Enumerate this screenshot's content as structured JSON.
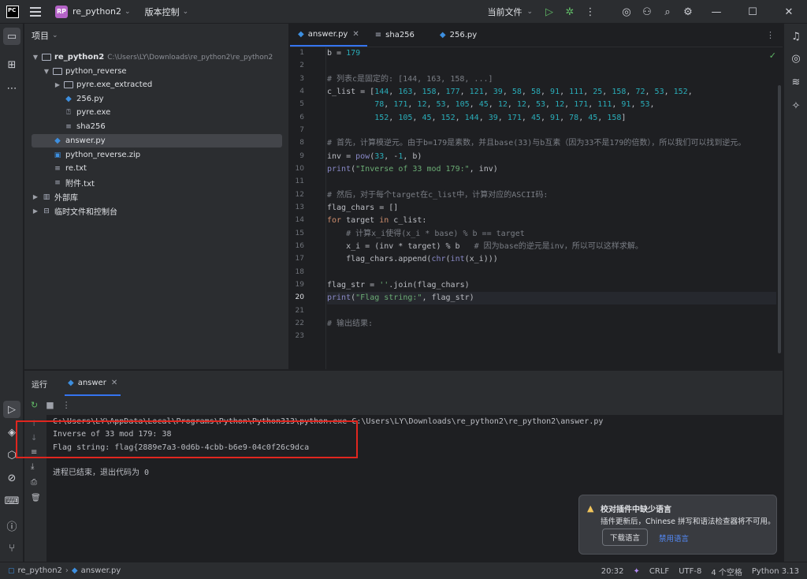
{
  "titlebar": {
    "project_badge": "RP",
    "project_name": "re_python2",
    "vcs": "版本控制",
    "run_config": "当前文件"
  },
  "project_panel": {
    "title": "项目",
    "tree": [
      {
        "label": "re_python2",
        "path": "C:\\Users\\LY\\Downloads\\re_python2\\re_python2"
      },
      {
        "label": "python_reverse"
      },
      {
        "label": "pyre.exe_extracted"
      },
      {
        "label": "256.py"
      },
      {
        "label": "pyre.exe"
      },
      {
        "label": "sha256"
      },
      {
        "label": "answer.py"
      },
      {
        "label": "python_reverse.zip"
      },
      {
        "label": "re.txt"
      },
      {
        "label": "附件.txt"
      },
      {
        "label": "外部库"
      },
      {
        "label": "临时文件和控制台"
      }
    ]
  },
  "editor": {
    "tabs": [
      {
        "label": "answer.py"
      },
      {
        "label": "sha256"
      },
      {
        "label": "256.py"
      }
    ],
    "line_numbers": [
      "1",
      "2",
      "3",
      "4",
      "5",
      "6",
      "7",
      "8",
      "9",
      "10",
      "11",
      "12",
      "13",
      "14",
      "15",
      "16",
      "17",
      "18",
      "19",
      "20",
      "21",
      "22",
      "23"
    ],
    "current_line": 20
  },
  "run_panel": {
    "title": "运行",
    "tab": "answer",
    "console": [
      "C:\\Users\\LY\\AppData\\Local\\Programs\\Python\\Python313\\python.exe C:\\Users\\LY\\Downloads\\re_python2\\re_python2\\answer.py",
      "Inverse of 33 mod 179: 38",
      "Flag string: flag{2889e7a3-0d6b-4cbb-b6e9-04c0f26c9dca",
      "",
      "进程已结束，退出代码为 0"
    ]
  },
  "notification": {
    "title": "校对插件中缺少语言",
    "body": "插件更新后，Chinese 拼写和语法检查器将不可用。",
    "button": "下载语言",
    "link": "禁用语言"
  },
  "statusbar": {
    "project": "re_python2",
    "file": "answer.py",
    "position": "20:32",
    "line_sep": "CRLF",
    "encoding": "UTF-8",
    "indent": "4 个空格",
    "interpreter": "Python 3.13"
  },
  "colors": {
    "accent": "#3574f0",
    "highlight_box": "#e0261f"
  }
}
